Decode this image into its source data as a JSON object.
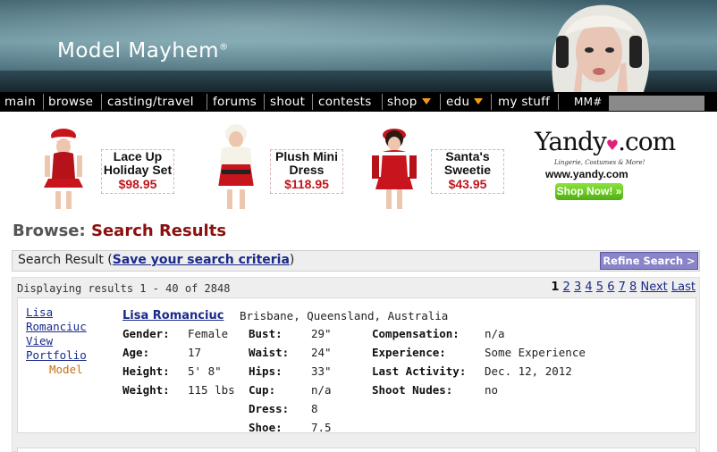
{
  "site": {
    "logo_text": "Model Mayhem",
    "logo_mark": "®"
  },
  "nav": {
    "items": [
      {
        "label": "main"
      },
      {
        "label": "browse"
      },
      {
        "label": "casting/travel"
      },
      {
        "label": "forums"
      },
      {
        "label": "shout"
      },
      {
        "label": "contests"
      },
      {
        "label": "shop"
      },
      {
        "label": "edu"
      },
      {
        "label": "my stuff"
      }
    ],
    "mm_label": "MM#"
  },
  "ads": {
    "products": [
      {
        "name_line1": "Lace Up",
        "name_line2": "Holiday Set",
        "price": "$98.95"
      },
      {
        "name_line1": "Plush Mini",
        "name_line2": "Dress",
        "price": "$118.95"
      },
      {
        "name_line1": "Santa's",
        "name_line2": "Sweetie",
        "price": "$43.95"
      }
    ],
    "brand": "Yandy",
    "brand_suffix": ".com",
    "tagline": "Lingerie, Costumes & More!",
    "url": "www.yandy.com",
    "cta": "Shop Now! »",
    "colors": {
      "price": "#c0161c",
      "cta": "#5cc41a",
      "heart": "#e0207a"
    }
  },
  "heading": {
    "prefix": "Browse:",
    "title": "Search Results"
  },
  "search_bar": {
    "label": "Search Result",
    "open_paren": "(",
    "save_link": "Save your search criteria",
    "close_paren": ")",
    "refine_button": "Refine Search >"
  },
  "results": {
    "displaying": "Displaying results 1 - 40 of 2848",
    "pager": {
      "current": "1",
      "pages": [
        "2",
        "3",
        "4",
        "5",
        "6",
        "7",
        "8"
      ],
      "next": "Next",
      "last": "Last"
    },
    "items": [
      {
        "side_name1": "Lisa",
        "side_name2": "Romanciuc",
        "portfolio": "View Portfolio",
        "role": "Model",
        "name": "Lisa Romanciuc",
        "location": "Brisbane, Queensland, Australia",
        "col1": [
          {
            "label": "Gender:",
            "value": "Female"
          },
          {
            "label": "Age:",
            "value": "17"
          },
          {
            "label": "Height:",
            "value": "5' 8\""
          },
          {
            "label": "Weight:",
            "value": "115 lbs"
          }
        ],
        "col2": [
          {
            "label": "Bust:",
            "value": "29\""
          },
          {
            "label": "Waist:",
            "value": "24\""
          },
          {
            "label": "Hips:",
            "value": "33\""
          },
          {
            "label": "Cup:",
            "value": "n/a"
          },
          {
            "label": "Dress:",
            "value": "8"
          },
          {
            "label": "Shoe:",
            "value": "7.5"
          }
        ],
        "col3": [
          {
            "label": "Compensation:",
            "value": "n/a"
          },
          {
            "label": "Experience:",
            "value": "Some Experience"
          },
          {
            "label": "Last Activity:",
            "value": "Dec. 12, 2012"
          },
          {
            "label": "Shoot Nudes:",
            "value": "no"
          }
        ]
      }
    ]
  }
}
